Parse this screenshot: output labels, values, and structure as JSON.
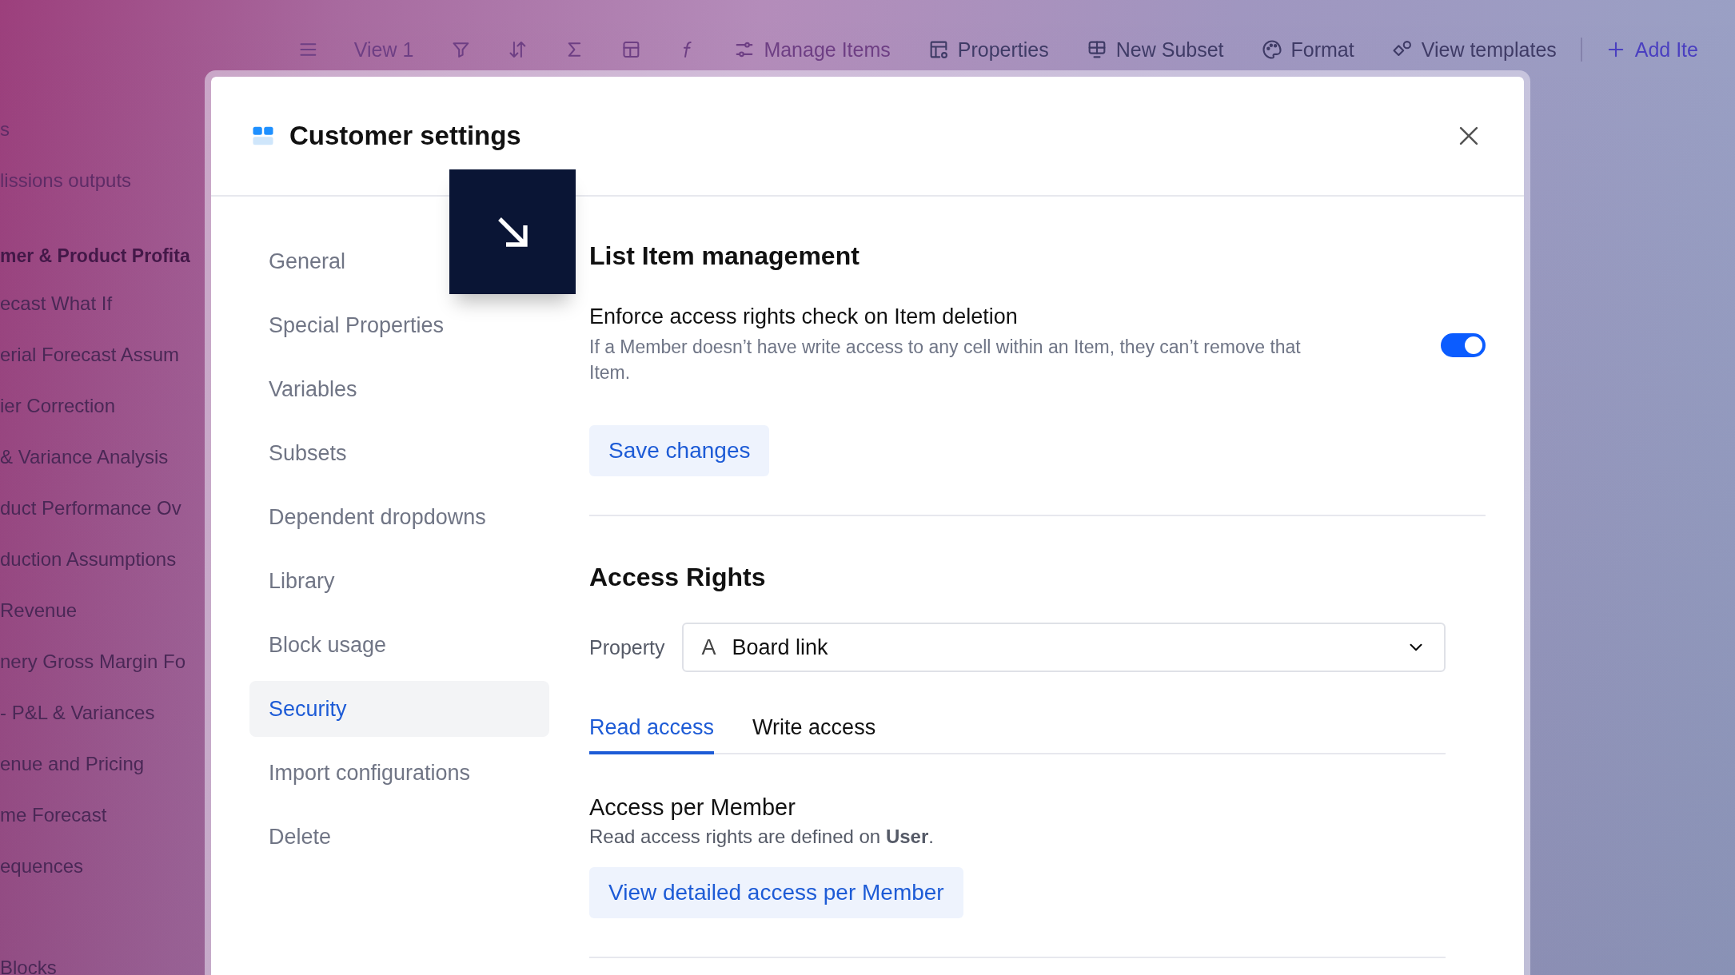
{
  "toolbar": {
    "items": [
      {
        "kind": "icon",
        "dimmed": true
      },
      {
        "kind": "button",
        "label": "View 1",
        "dimmed": true
      },
      {
        "kind": "icon",
        "dimmed": true
      },
      {
        "kind": "icon",
        "dimmed": true
      },
      {
        "kind": "icon",
        "dimmed": true
      },
      {
        "kind": "icon",
        "dimmed": true
      },
      {
        "kind": "icon",
        "dimmed": true
      },
      {
        "kind": "button",
        "label": "Manage Items",
        "dimmed": true
      },
      {
        "kind": "button",
        "label": "Properties",
        "dimmed": false
      },
      {
        "kind": "button",
        "label": "New Subset",
        "dimmed": false
      },
      {
        "kind": "button",
        "label": "Format",
        "dimmed": false
      },
      {
        "kind": "button",
        "label": "View templates",
        "dimmed": false
      },
      {
        "kind": "add",
        "label": "Add Ite",
        "dimmed": false
      }
    ]
  },
  "background_list": {
    "items": [
      {
        "kind": "faded",
        "label": "s"
      },
      {
        "kind": "faded",
        "label": "lissions outputs"
      },
      {
        "kind": "header",
        "label": "mer & Product Profita"
      },
      {
        "kind": "item",
        "label": "ecast What If"
      },
      {
        "kind": "item",
        "label": "erial Forecast Assum"
      },
      {
        "kind": "item",
        "label": "ier Correction"
      },
      {
        "kind": "item",
        "label": "& Variance Analysis"
      },
      {
        "kind": "item",
        "label": "duct Performance Ov"
      },
      {
        "kind": "item",
        "label": "duction Assumptions"
      },
      {
        "kind": "item",
        "label": "Revenue"
      },
      {
        "kind": "item",
        "label": "nery Gross Margin Fo"
      },
      {
        "kind": "item",
        "label": "- P&L & Variances"
      },
      {
        "kind": "item",
        "label": "enue and Pricing"
      },
      {
        "kind": "item",
        "label": "me Forecast"
      },
      {
        "kind": "item",
        "label": "equences"
      },
      {
        "kind": "item",
        "label": "Blocks"
      }
    ]
  },
  "dialog": {
    "title": "Customer settings",
    "nav": [
      {
        "label": "General",
        "selected": false
      },
      {
        "label": "Special Properties",
        "selected": false
      },
      {
        "label": "Variables",
        "selected": false
      },
      {
        "label": "Subsets",
        "selected": false
      },
      {
        "label": "Dependent dropdowns",
        "selected": false
      },
      {
        "label": "Library",
        "selected": false
      },
      {
        "label": "Block usage",
        "selected": false
      },
      {
        "label": "Security",
        "selected": true
      },
      {
        "label": "Import configurations",
        "selected": false
      },
      {
        "label": "Delete",
        "selected": false
      }
    ],
    "list_item_management": {
      "heading": "List Item management",
      "setting": {
        "label": "Enforce access rights check on Item deletion",
        "description": "If a Member doesn’t have write access to any cell within an Item, they can’t remove that Item.",
        "on": true
      },
      "save_button": "Save changes"
    },
    "access_rights": {
      "heading": "Access Rights",
      "property": {
        "label": "Property",
        "icon": "A",
        "value": "Board link"
      },
      "tabs": [
        {
          "label": "Read access",
          "selected": true
        },
        {
          "label": "Write access",
          "selected": false
        }
      ],
      "access_per_member": {
        "title": "Access per Member",
        "description": "Read access rights are defined on **User**.",
        "button": "View detailed access per Member"
      }
    }
  }
}
